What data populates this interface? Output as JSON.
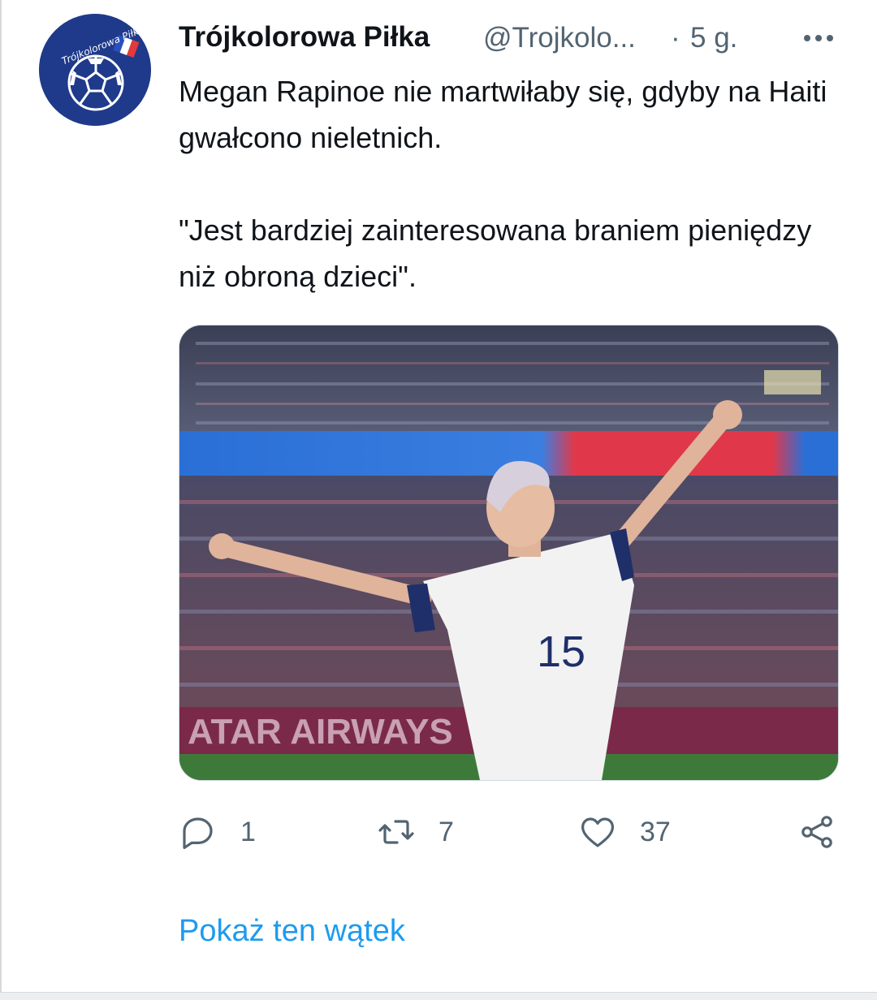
{
  "tweet": {
    "display_name": "Trójkolorowa Piłka",
    "handle": "@Trojkolo...",
    "separator": "·",
    "time": "5 g.",
    "avatar_text": "Trójkolorowa Piłka",
    "paragraphs": [
      "Megan Rapinoe nie martwiłaby się, gdyby na Haiti gwałcono nieletnich.",
      "\"Jest bardziej zainteresowana braniem pieniędzy niż obroną dzieci\"."
    ],
    "media": {
      "description": "photo",
      "jersey_number": "15",
      "banner_text": "ATAR AIRWAYS"
    },
    "actions": {
      "reply": {
        "icon": "reply-icon",
        "count": "1"
      },
      "retweet": {
        "icon": "retweet-icon",
        "count": "7"
      },
      "like": {
        "icon": "heart-icon",
        "count": "37"
      },
      "share": {
        "icon": "share-icon"
      }
    },
    "show_thread": "Pokaż ten wątek"
  },
  "colors": {
    "text": "#0f1419",
    "secondary": "#536471",
    "link": "#1d9bf0",
    "avatar_bg": "#1f3a8a"
  }
}
